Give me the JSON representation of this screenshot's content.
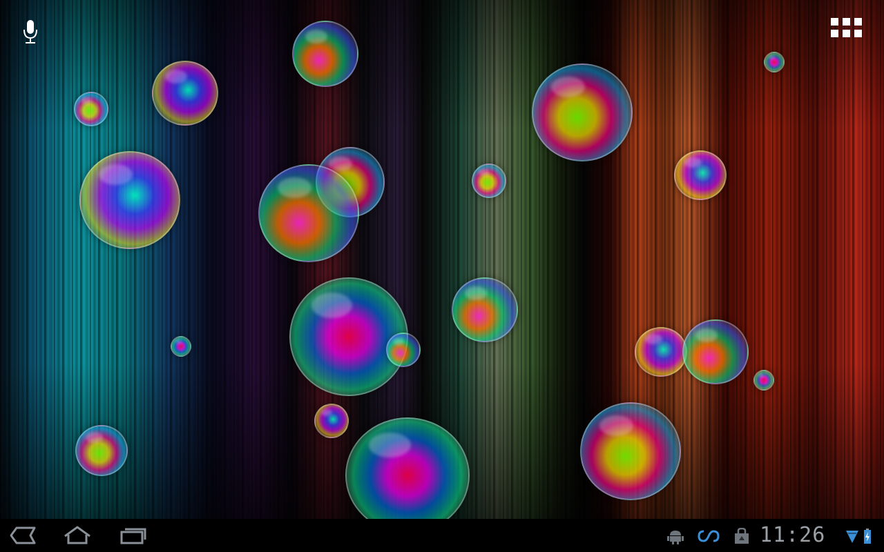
{
  "screen": {
    "type": "android-tablet-homescreen",
    "wallpaper": "live-bubbles"
  },
  "top_bar": {
    "voice_search_icon": "microphone-icon",
    "apps_icon": "apps-grid-icon"
  },
  "system_bar": {
    "nav": {
      "back_icon": "back-icon",
      "home_icon": "home-icon",
      "recents_icon": "recent-apps-icon"
    },
    "notifications": [
      {
        "icon": "android-debug-icon"
      },
      {
        "icon": "sync-icon"
      },
      {
        "icon": "market-icon"
      }
    ],
    "clock": "11:26",
    "wifi_icon": "wifi-signal-icon",
    "battery_icon": "battery-charging-icon"
  },
  "colors": {
    "system_bar_bg": "#000000",
    "system_icon": "#8a9199",
    "wifi_accent": "#3a8fd6",
    "battery_accent": "#3a8fd6",
    "apps_icon": "#ffffff"
  }
}
